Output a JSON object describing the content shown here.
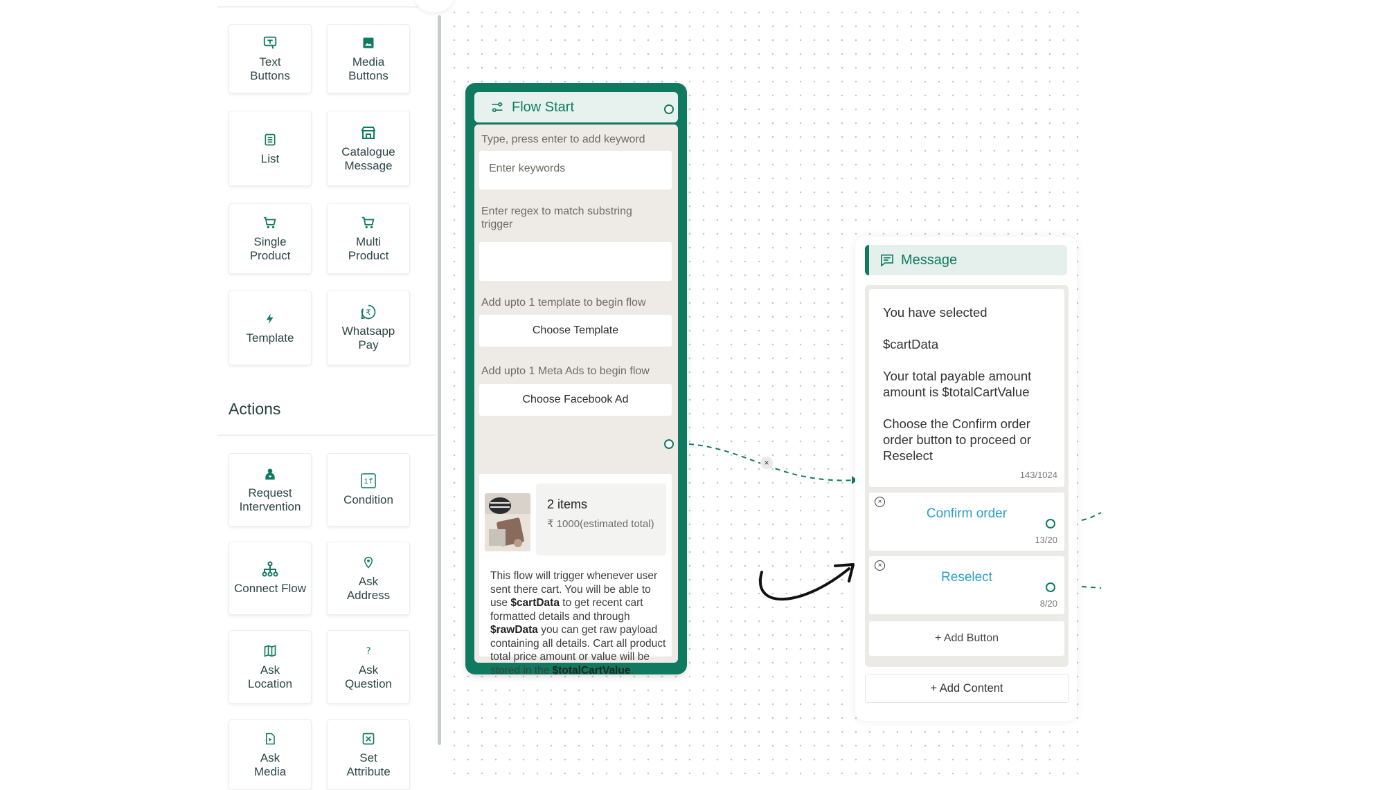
{
  "sidebar": {
    "messages_tiles": [
      {
        "label": "Text\nButtons",
        "icon": "text-buttons-icon"
      },
      {
        "label": "Media\nButtons",
        "icon": "image-icon"
      },
      {
        "label": "List",
        "icon": "list-icon"
      },
      {
        "label": "Catalogue\nMessage",
        "icon": "store-icon"
      },
      {
        "label": "Single\nProduct",
        "icon": "cart-icon"
      },
      {
        "label": "Multi\nProduct",
        "icon": "cart-icon"
      },
      {
        "label": "Template",
        "icon": "lightning-icon"
      },
      {
        "label": "Whatsapp\nPay",
        "icon": "rupee-icon"
      }
    ],
    "actions_title": "Actions",
    "action_tiles": [
      {
        "label": "Request\nIntervention",
        "icon": "agent-icon"
      },
      {
        "label": "Condition",
        "icon": "if-icon"
      },
      {
        "label": "Connect Flow",
        "icon": "hierarchy-icon"
      },
      {
        "label": "Ask\nAddress",
        "icon": "location-pin-icon"
      },
      {
        "label": "Ask\nLocation",
        "icon": "map-icon"
      },
      {
        "label": "Ask\nQuestion",
        "icon": "question-icon"
      },
      {
        "label": "Ask\nMedia",
        "icon": "file-media-icon"
      },
      {
        "label": "Set\nAttribute",
        "icon": "attribute-icon"
      }
    ]
  },
  "flow_start": {
    "title": "Flow Start",
    "keyword_label": "Type, press enter to add keyword",
    "keyword_placeholder": "Enter keywords",
    "regex_label": "Enter regex to match substring trigger",
    "regex_value": "",
    "template_label": "Add upto 1 template to begin flow",
    "template_button": "Choose Template",
    "meta_ads_label": "Add upto 1 Meta Ads to begin flow",
    "meta_ads_button": "Choose Facebook Ad",
    "cart": {
      "items": "2 items",
      "price": "₹ 1000(estimated total)",
      "desc_1": "This flow will trigger whenever user sent there cart. You will be able to use ",
      "var_cart": "$cartData",
      "desc_2": " to get recent cart formatted details and through ",
      "var_raw": "$rawData",
      "desc_3": " you can get raw payload containing all details. Cart all product total price amount or value will be stored in the ",
      "var_total": "$totalCartValue",
      "desc_4": "."
    }
  },
  "message_node": {
    "title": "Message",
    "lines": [
      "You have selected",
      "$cartData",
      "Your total payable amount amount is $totalCartValue",
      "Choose the Confirm order order button to proceed or Reselect"
    ],
    "text_counter": "143/1024",
    "buttons": [
      {
        "label": "Confirm order",
        "counter": "13/20"
      },
      {
        "label": "Reselect",
        "counter": "8/20"
      }
    ],
    "add_button": "+ Add Button",
    "add_content": "+ Add Content"
  },
  "edge_delete": "×",
  "colors": {
    "brand_green": "#0f7a5f",
    "button_text_blue": "#2b9fcb",
    "node_bg": "#eeebe6"
  }
}
